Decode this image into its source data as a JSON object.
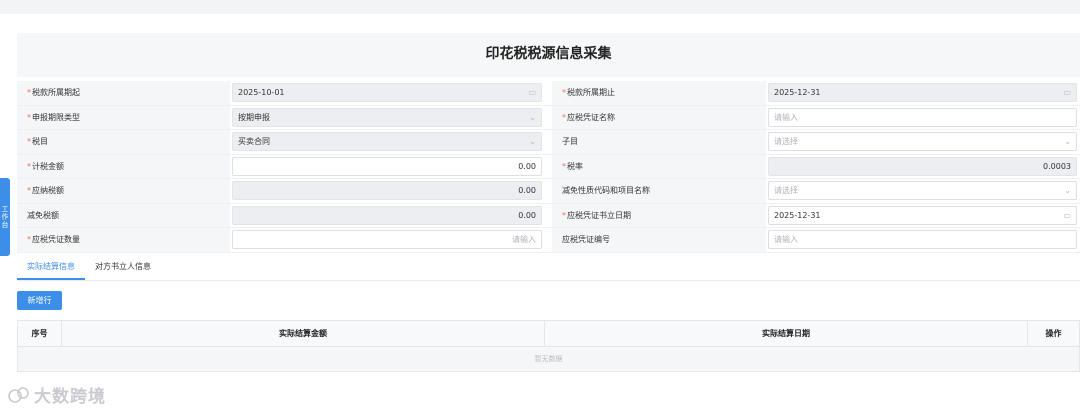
{
  "side_tab": {
    "label": "工作台"
  },
  "title": "印花税税源信息采集",
  "rows": [
    {
      "left": {
        "label": "税款所属期起",
        "required": true,
        "value": "2025-10-01",
        "placeholder": "",
        "icon": "calendar-icon",
        "disabled": true,
        "numeric": false
      },
      "right": {
        "label": "税款所属期止",
        "required": true,
        "value": "2025-12-31",
        "placeholder": "",
        "icon": "calendar-icon",
        "disabled": true,
        "numeric": false
      }
    },
    {
      "left": {
        "label": "申报期限类型",
        "required": true,
        "value": "按期申报",
        "placeholder": "",
        "icon": "chevron-down-icon",
        "disabled": true,
        "numeric": false
      },
      "right": {
        "label": "应税凭证名称",
        "required": true,
        "value": "",
        "placeholder": "请输入",
        "icon": "",
        "disabled": false,
        "numeric": false
      }
    },
    {
      "left": {
        "label": "税目",
        "required": true,
        "value": "买卖合同",
        "placeholder": "",
        "icon": "chevron-down-icon",
        "disabled": true,
        "numeric": false
      },
      "right": {
        "label": "子目",
        "required": false,
        "value": "",
        "placeholder": "请选择",
        "icon": "chevron-down-icon",
        "disabled": false,
        "numeric": false
      }
    },
    {
      "left": {
        "label": "计税金额",
        "required": true,
        "value": "0.00",
        "placeholder": "",
        "icon": "",
        "disabled": false,
        "numeric": true
      },
      "right": {
        "label": "税率",
        "required": true,
        "value": "0.0003",
        "placeholder": "",
        "icon": "",
        "disabled": true,
        "numeric": true
      }
    },
    {
      "left": {
        "label": "应纳税额",
        "required": true,
        "value": "0.00",
        "placeholder": "",
        "icon": "",
        "disabled": true,
        "numeric": true
      },
      "right": {
        "label": "减免性质代码和项目名称",
        "required": false,
        "value": "",
        "placeholder": "请选择",
        "icon": "chevron-down-icon",
        "disabled": false,
        "numeric": false
      }
    },
    {
      "left": {
        "label": "减免税额",
        "required": false,
        "value": "0.00",
        "placeholder": "",
        "icon": "",
        "disabled": true,
        "numeric": true
      },
      "right": {
        "label": "应税凭证书立日期",
        "required": true,
        "value": "2025-12-31",
        "placeholder": "",
        "icon": "calendar-icon",
        "disabled": false,
        "numeric": false
      }
    },
    {
      "left": {
        "label": "应税凭证数量",
        "required": true,
        "value": "",
        "placeholder": "请输入",
        "icon": "",
        "disabled": false,
        "numeric": true
      },
      "right": {
        "label": "应税凭证编号",
        "required": false,
        "value": "",
        "placeholder": "请输入",
        "icon": "",
        "disabled": false,
        "numeric": false
      }
    }
  ],
  "tabs": [
    {
      "label": "实际结算信息",
      "active": true
    },
    {
      "label": "对方书立人信息",
      "active": false
    }
  ],
  "add_button": "新增行",
  "table": {
    "columns": [
      "序号",
      "实际结算金额",
      "实际结算日期",
      "操作"
    ],
    "empty_text": "暂无数据"
  },
  "watermark": "大数跨境",
  "colors": {
    "accent": "#3d8ee8",
    "required": "#f56c6c"
  }
}
